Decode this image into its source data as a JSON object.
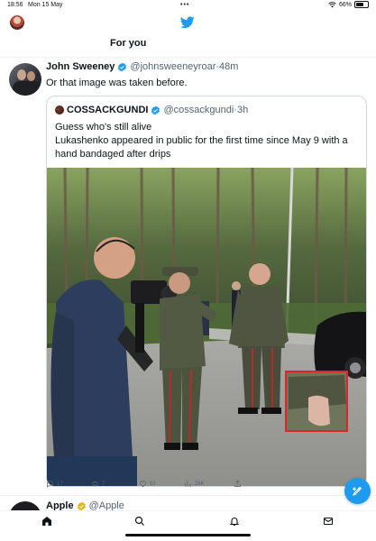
{
  "status_bar": {
    "time": "18:56",
    "date": "Mon 15 May",
    "battery": "66%",
    "battery_level": 0.66
  },
  "header": {
    "active_tab": "For you"
  },
  "tweet": {
    "name": "John Sweeney",
    "handle": "@johnsweeneyroar",
    "separator": "·",
    "age": "48m",
    "text": "Or that image was taken before.",
    "quote": {
      "name": "COSSACKGUNDI",
      "handle": "@cossackgundi",
      "separator": "·",
      "age": "3h",
      "text_line1": "Guess who's still alive",
      "text_line2": "Lukashenko appeared in public for the first time since May 9 with a hand bandaged after drips"
    },
    "actions": {
      "replies": "17",
      "retweets": "7",
      "likes": "82",
      "views": "26K"
    }
  },
  "next_tweet": {
    "name": "Apple",
    "handle": "@Apple"
  },
  "colors": {
    "accent": "#1d9bf0",
    "text": "#0f1419",
    "secondary": "#536471",
    "border": "#cfd9de",
    "highlight_box": "#e0242a"
  },
  "icons": {
    "home": "home-icon",
    "search": "search-icon",
    "notifications": "bell-icon",
    "messages": "envelope-icon",
    "compose": "compose-icon",
    "logo": "twitter-bird-icon"
  }
}
